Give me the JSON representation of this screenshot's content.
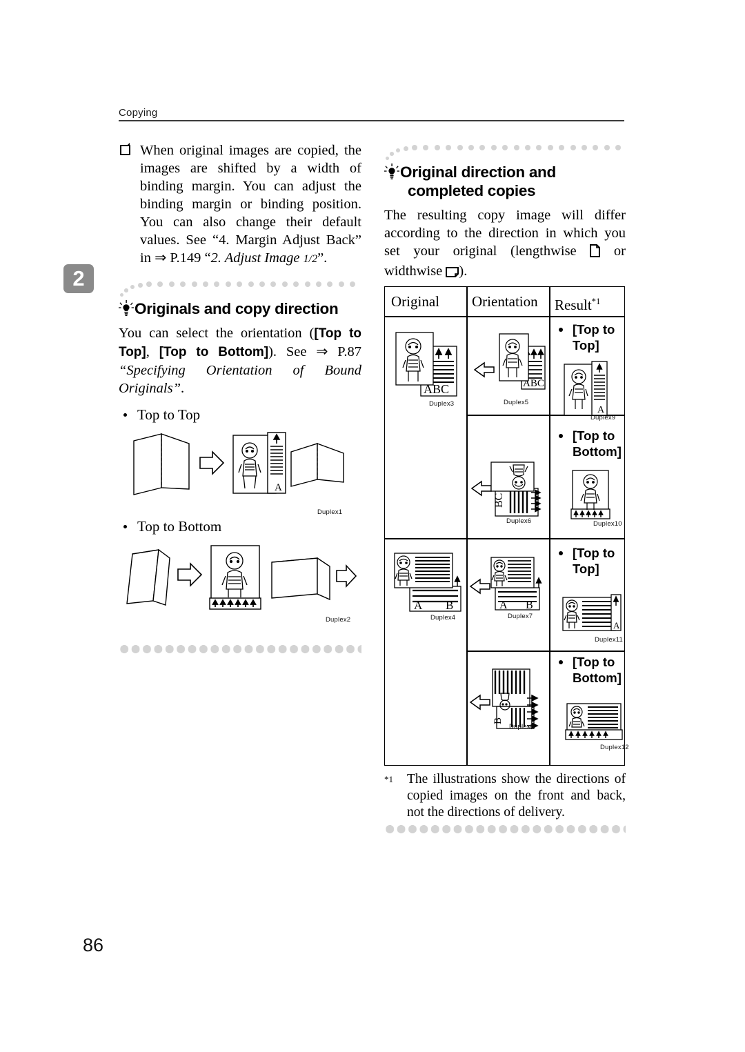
{
  "header": {
    "running_title": "Copying",
    "chapter_tab": "2",
    "page_number": "86"
  },
  "left_column": {
    "limitation_note": {
      "icon": "limitation-square-icon",
      "text_parts": {
        "p1": "When original images are copied, the images are shifted by a width of binding margin. You can adjust the binding margin or binding position. You can also change their default values. See “4. Margin Adjust Back” in ",
        "arrow": "⇒",
        "p2": " P.149 “",
        "italic1": "2. Adjust Image ",
        "frac": "1/2",
        "p3": "”."
      },
      "full_text": "When original images are copied, the images are shifted by a width of binding margin. You can adjust the binding margin or binding position. You can also change their default values. See “4. Margin Adjust Back” in ⇒ P.149 “2. Adjust Image 1/2”."
    },
    "tip": {
      "icon": "lightbulb-icon",
      "heading": "Originals and copy direction",
      "body_parts": {
        "t1": "You can select the orientation (",
        "kw1": "[Top to Top]",
        "t2": ", ",
        "kw2": "[Top to Bottom]",
        "t3": "). See ",
        "arrow": "⇒",
        "t4": " P.87 ",
        "italic": "“Specifying Orientation of Bound Originals”",
        "t5": "."
      },
      "body_full": "You can select the orientation ([Top to Top], [Top to Bottom]). See ⇒ P.87 “Specifying Orientation of Bound Originals”."
    },
    "bullets": [
      {
        "label": "Top to Top",
        "figure_caption": "Duplex1"
      },
      {
        "label": "Top to Bottom",
        "figure_caption": "Duplex2"
      }
    ]
  },
  "right_column": {
    "tip": {
      "icon": "lightbulb-icon",
      "heading_line1": "Original direction and",
      "heading_line2": "completed copies",
      "body_parts": {
        "t1": "The resulting copy image will differ according to the direction in which you set your original (lengthwise ",
        "icon1": "page-portrait-icon",
        "t2": " or widthwise ",
        "icon2": "page-landscape-icon",
        "t3": ")."
      },
      "body_full": "The resulting copy image will differ according to the direction in which you set your original (lengthwise ⎕ or widthwise ⎕)."
    },
    "table": {
      "columns": [
        "Original",
        "Orientation",
        "Result"
      ],
      "result_footnote_mark": "*1",
      "rows": [
        {
          "original_caption": "Duplex3",
          "orientation": [
            {
              "caption": "Duplex5"
            },
            {
              "caption": "Duplex6"
            }
          ],
          "results": [
            {
              "label": "[Top to Top]",
              "caption": "Duplex9"
            },
            {
              "label": "[Top to Bottom]",
              "caption": "Duplex10"
            }
          ]
        },
        {
          "original_caption": "Duplex4",
          "orientation": [
            {
              "caption": "Duplex7"
            },
            {
              "caption": "Duplex8"
            }
          ],
          "results": [
            {
              "label": "[Top to Top]",
              "caption": "Duplex11"
            },
            {
              "label": "[Top to Bottom]",
              "caption": "Duplex12"
            }
          ]
        }
      ]
    },
    "footnote": {
      "mark": "*1",
      "text": "The illustrations show the directions of copied images on the front and back, not the directions of delivery."
    }
  },
  "colors": {
    "chapter_tab_bg": "#8a8a8a",
    "dot_rule": "#d3d3d3",
    "rule": "#3a3a3a",
    "text": "#000000"
  }
}
